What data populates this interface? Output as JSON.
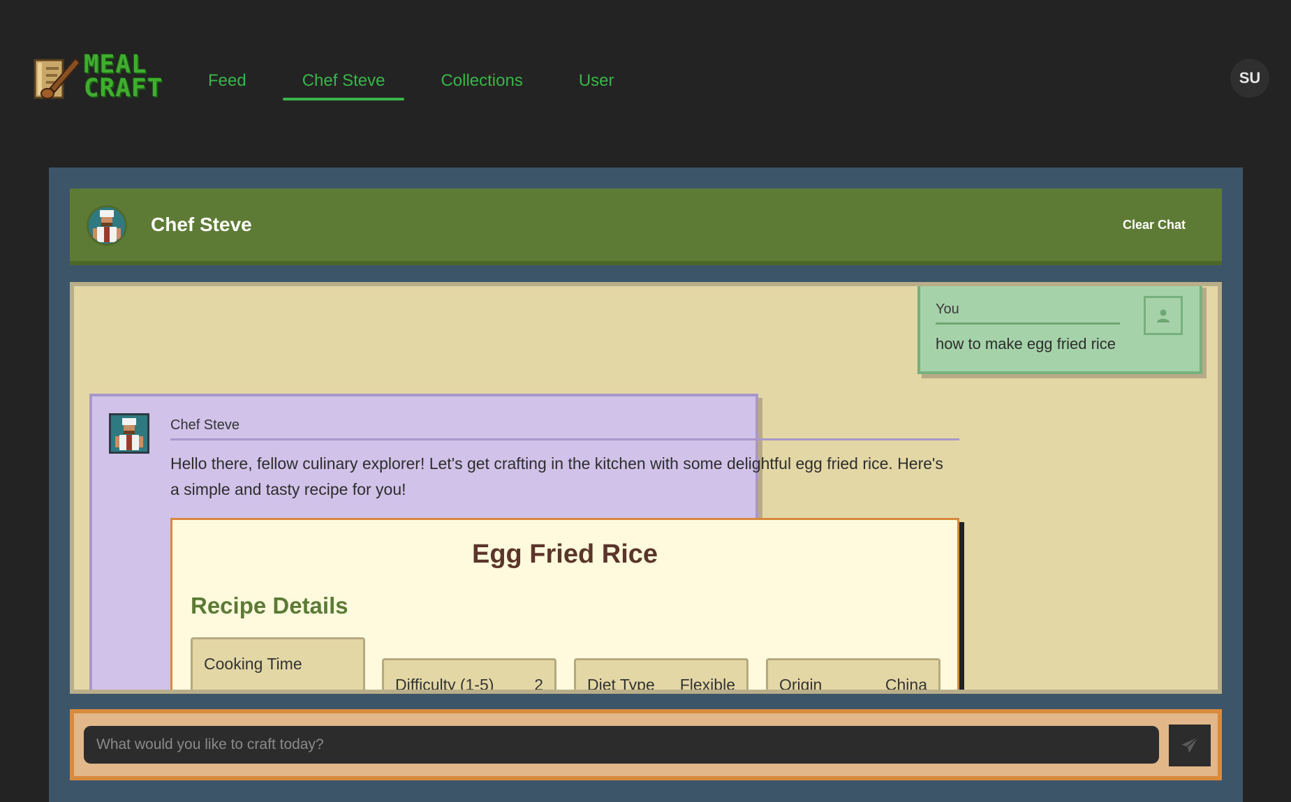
{
  "app": {
    "logo_line1": "MEAL",
    "logo_line2": "CRAFT",
    "accent": "#39b549"
  },
  "nav": {
    "items": [
      {
        "label": "Feed",
        "active": false
      },
      {
        "label": "Chef Steve",
        "active": true
      },
      {
        "label": "Collections",
        "active": false
      },
      {
        "label": "User",
        "active": false
      }
    ]
  },
  "user_avatar": {
    "initials": "SU"
  },
  "chat_header": {
    "title": "Chef Steve",
    "clear_label": "Clear Chat"
  },
  "messages": {
    "user": {
      "sender": "You",
      "text": "how to make egg fried rice"
    },
    "bot": {
      "sender": "Chef Steve",
      "text": "Hello there, fellow culinary explorer! Let's get crafting in the kitchen with some delightful egg fried rice. Here's a simple and tasty recipe for you!"
    }
  },
  "recipe": {
    "title": "Egg Fried Rice",
    "section": "Recipe Details",
    "details": [
      {
        "label": "Cooking Time",
        "value": ""
      },
      {
        "label": "Difficulty (1-5)",
        "value": "2"
      },
      {
        "label": "Diet Type",
        "value": "Flexible"
      },
      {
        "label": "Origin",
        "value": "China"
      }
    ]
  },
  "composer": {
    "placeholder": "What would you like to craft today?"
  }
}
